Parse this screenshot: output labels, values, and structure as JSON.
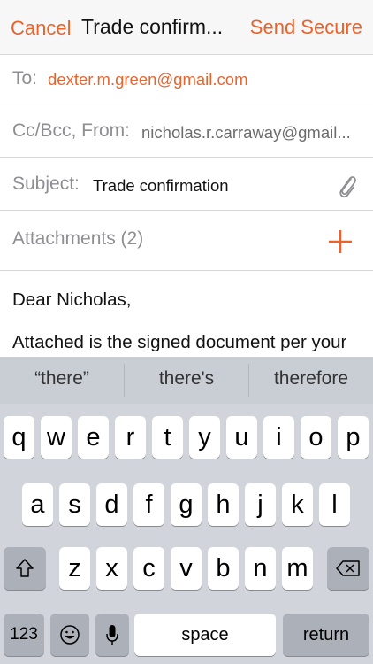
{
  "nav": {
    "cancel": "Cancel",
    "title": "Trade confirm...",
    "send": "Send Secure"
  },
  "fields": {
    "to_label": "To:",
    "to_value": "dexter.m.green@gmail.com",
    "cc_label": "Cc/Bcc, From:",
    "cc_value": "nicholas.r.carraway@gmail...",
    "subject_label": "Subject:",
    "subject_value": "Trade confirmation",
    "attachments_label": "Attachments (2)"
  },
  "body": {
    "line1": "Dear Nicholas,",
    "line2": "Attached is the signed document per your"
  },
  "suggestions": [
    "“there”",
    "there's",
    "therefore"
  ],
  "keyboard": {
    "row1": [
      "q",
      "w",
      "e",
      "r",
      "t",
      "y",
      "u",
      "i",
      "o",
      "p"
    ],
    "row2": [
      "a",
      "s",
      "d",
      "f",
      "g",
      "h",
      "j",
      "k",
      "l"
    ],
    "row3": [
      "z",
      "x",
      "c",
      "v",
      "b",
      "n",
      "m"
    ],
    "numbers_label": "123",
    "space_label": "space",
    "return_label": "return"
  },
  "colors": {
    "accent": "#e8642c"
  },
  "icons": [
    "paperclip-icon",
    "plus-icon",
    "shift-icon",
    "delete-icon",
    "emoji-icon",
    "microphone-icon"
  ]
}
